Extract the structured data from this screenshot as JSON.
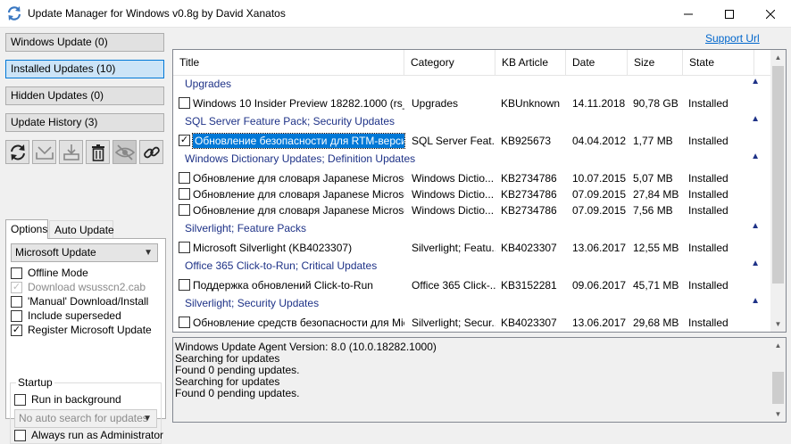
{
  "window": {
    "title": "Update Manager for Windows v0.8g by David Xanatos",
    "controls": [
      "minimize-icon",
      "maximize-icon",
      "close-icon"
    ]
  },
  "nav": {
    "windows_update": "Windows Update (0)",
    "installed_updates": "Installed Updates (10)",
    "hidden_updates": "Hidden Updates (0)",
    "update_history": "Update History (3)"
  },
  "toolbar": {
    "icons": [
      "refresh-icon",
      "download-icon",
      "install-icon",
      "trash-icon",
      "hide-icon",
      "link-icon"
    ]
  },
  "tabs": {
    "options": "Options",
    "auto_update": "Auto Update"
  },
  "options": {
    "source_selected": "Microsoft Update",
    "offline_mode": "Offline Mode",
    "download_cab": "Download wsusscn2.cab",
    "manual_download": "'Manual' Download/Install",
    "include_superseded": "Include superseded",
    "register_ms_update": "Register Microsoft Update",
    "startup_group": "Startup",
    "run_in_background": "Run in background",
    "auto_search_selected": "No auto search for updates",
    "always_admin": "Always run as Administrator",
    "checked": {
      "offline_mode": false,
      "download_cab": true,
      "manual_download": false,
      "include_superseded": false,
      "register_ms_update": true,
      "run_in_background": false,
      "always_admin": false
    }
  },
  "support_link": "Support Url",
  "list": {
    "columns": [
      "Title",
      "Category",
      "KB Article",
      "Date",
      "Size",
      "State"
    ],
    "groups": [
      {
        "name": "Upgrades",
        "rows": [
          {
            "title": "Windows 10 Insider Preview 18282.1000 (rs_pr...",
            "category": "Upgrades",
            "kb": "KBUnknown",
            "date": "14.11.2018",
            "size": "90,78 GB",
            "state": "Installed",
            "checked": false,
            "selected": false
          }
        ]
      },
      {
        "name": "SQL Server Feature Pack; Security Updates",
        "rows": [
          {
            "title": "Обновление безопасности для RTM-версии ...",
            "category": "SQL Server Feat...",
            "kb": "KB925673",
            "date": "04.04.2012",
            "size": "1,77 MB",
            "state": "Installed",
            "checked": true,
            "selected": true
          }
        ]
      },
      {
        "name": "Windows Dictionary Updates; Definition Updates",
        "rows": [
          {
            "title": "Обновление для словаря Japanese Microsoft ...",
            "category": "Windows Dictio...",
            "kb": "KB2734786",
            "date": "10.07.2015",
            "size": "5,07 MB",
            "state": "Installed",
            "checked": false,
            "selected": false
          },
          {
            "title": "Обновление для словаря Japanese Microsoft ...",
            "category": "Windows Dictio...",
            "kb": "KB2734786",
            "date": "07.09.2015",
            "size": "27,84 MB",
            "state": "Installed",
            "checked": false,
            "selected": false
          },
          {
            "title": "Обновление для словаря Japanese Microsoft ...",
            "category": "Windows Dictio...",
            "kb": "KB2734786",
            "date": "07.09.2015",
            "size": "7,56 MB",
            "state": "Installed",
            "checked": false,
            "selected": false
          }
        ]
      },
      {
        "name": "Silverlight; Feature Packs",
        "rows": [
          {
            "title": "Microsoft Silverlight (KB4023307)",
            "category": "Silverlight; Featu...",
            "kb": "KB4023307",
            "date": "13.06.2017",
            "size": "12,55 MB",
            "state": "Installed",
            "checked": false,
            "selected": false
          }
        ]
      },
      {
        "name": "Office 365 Click-to-Run; Critical Updates",
        "rows": [
          {
            "title": "Поддержка обновлений Click-to-Run",
            "category": "Office 365 Click-...",
            "kb": "KB3152281",
            "date": "09.06.2017",
            "size": "45,71 MB",
            "state": "Installed",
            "checked": false,
            "selected": false
          }
        ]
      },
      {
        "name": "Silverlight; Security Updates",
        "rows": [
          {
            "title": "Обновление средств безопасности для Micr...",
            "category": "Silverlight; Secur...",
            "kb": "KB4023307",
            "date": "13.06.2017",
            "size": "29,68 MB",
            "state": "Installed",
            "checked": false,
            "selected": false
          }
        ]
      }
    ]
  },
  "log": [
    "Windows Update Agent Version: 8.0 (10.0.18282.1000)",
    "Searching for updates",
    "Found 0 pending updates.",
    "Searching for updates",
    "Found 0 pending updates."
  ]
}
